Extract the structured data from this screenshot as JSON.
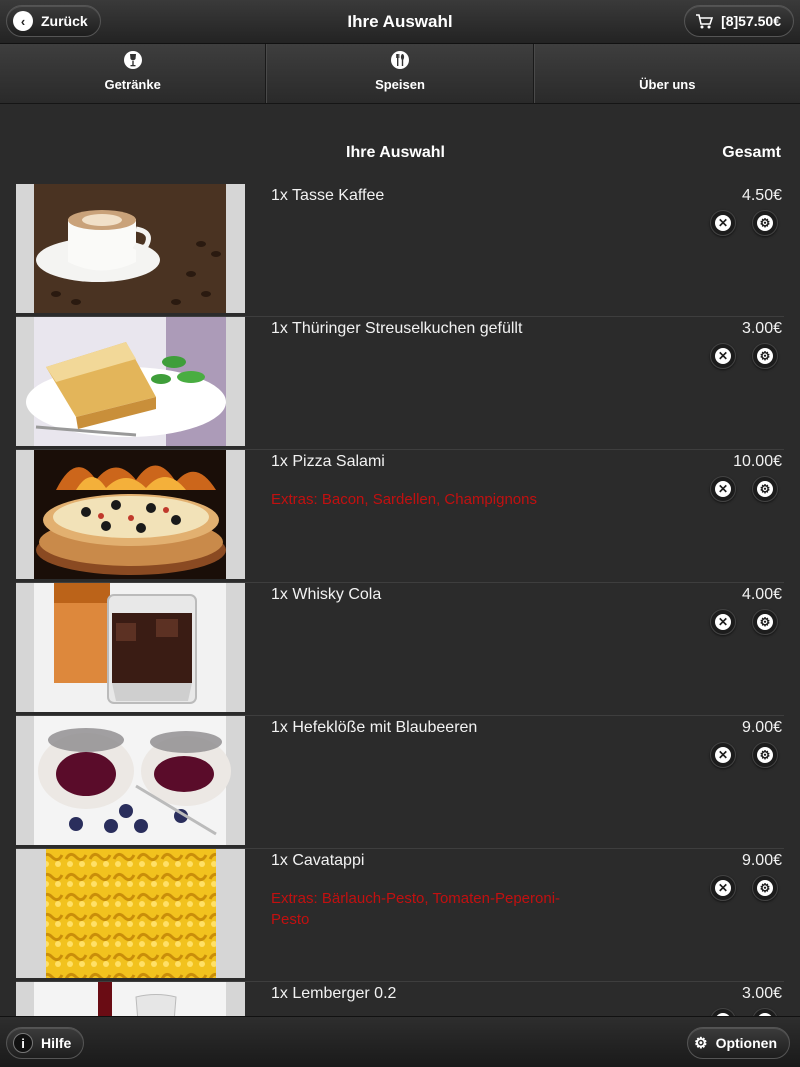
{
  "header": {
    "back_label": "Zurück",
    "title": "Ihre Auswahl",
    "cart_label": "[8]57.50€"
  },
  "tabs": [
    {
      "label": "Getränke",
      "icon": "wine-glass-icon"
    },
    {
      "label": "Speisen",
      "icon": "cutlery-icon"
    },
    {
      "label": "Über uns",
      "icon": ""
    }
  ],
  "list": {
    "col_selection": "Ihre Auswahl",
    "col_total": "Gesamt"
  },
  "items": [
    {
      "name": "1x Tasse Kaffee",
      "price": "4.50€",
      "extras": "",
      "image": "coffee-cup"
    },
    {
      "name": "1x Thüringer Streuselkuchen gefüllt",
      "price": "3.00€",
      "extras": "",
      "image": "crumb-cake"
    },
    {
      "name": "1x Pizza Salami",
      "price": "10.00€",
      "extras": "Extras: Bacon, Sardellen, Champignons",
      "image": "pizza"
    },
    {
      "name": "1x Whisky Cola",
      "price": "4.00€",
      "extras": "",
      "image": "whisky-cola"
    },
    {
      "name": "1x Hefeklöße mit Blaubeeren",
      "price": "9.00€",
      "extras": "",
      "image": "dumplings-blueberries"
    },
    {
      "name": "1x Cavatappi",
      "price": "9.00€",
      "extras": "Extras: Bärlauch-Pesto, Tomaten-Peperoni-Pesto",
      "image": "cavatappi-pasta"
    },
    {
      "name": "1x Lemberger 0.2",
      "price": "3.00€",
      "extras": "",
      "image": "red-wine"
    }
  ],
  "footer": {
    "help_label": "Hilfe",
    "options_label": "Optionen"
  },
  "colors": {
    "background": "#2b2b2b",
    "extras_text": "#c21010"
  }
}
